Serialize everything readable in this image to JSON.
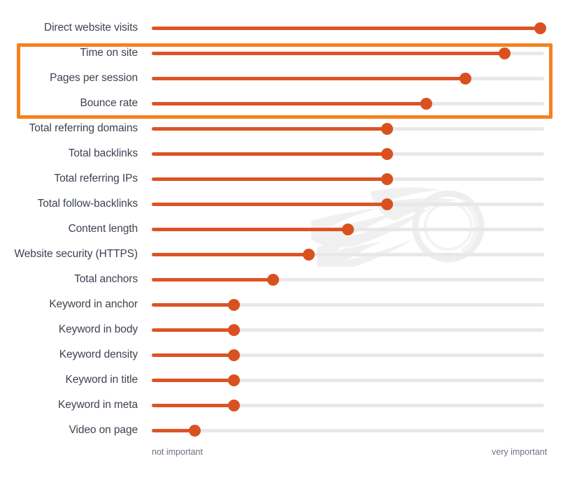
{
  "chart_data": {
    "type": "bar",
    "subtype": "lollipop-horizontal",
    "title": "",
    "subtitle": "",
    "xlabel": "",
    "ylabel": "",
    "grid": false,
    "legend": null,
    "xlim": [
      0,
      100
    ],
    "axis_labels": {
      "left": "not important",
      "right": "very important"
    },
    "categories": [
      "Direct website visits",
      "Time on site",
      "Pages per session",
      "Bounce rate",
      "Total referring domains",
      "Total backlinks",
      "Total referring IPs",
      "Total follow-backlinks",
      "Content length",
      "Website security (HTTPS)",
      "Total anchors",
      "Keyword in anchor",
      "Keyword in body",
      "Keyword density",
      "Keyword in title",
      "Keyword in meta",
      "Video on page"
    ],
    "values": [
      99,
      90,
      80,
      70,
      60,
      60,
      60,
      60,
      50,
      40,
      31,
      21,
      21,
      21,
      21,
      21,
      11
    ],
    "highlighted_categories": [
      "Time on site",
      "Pages per session",
      "Bounce rate"
    ]
  },
  "colors": {
    "dot": "#D9511F",
    "fill": "#DB5425",
    "track": "#e8e8e8",
    "highlight_border": "#F58220",
    "label_text": "#3c4350",
    "axis_text": "#6b7280",
    "background": "#ffffff",
    "watermark": "#f1f1f1"
  },
  "highlight": {
    "present": true,
    "label": "highlighted-engagement-metrics"
  },
  "watermark": {
    "present": true,
    "icon": "flame-ring-watermark"
  }
}
